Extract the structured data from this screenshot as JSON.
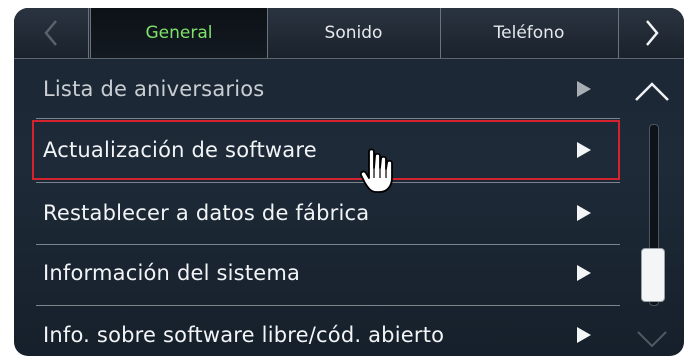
{
  "tabs": [
    {
      "label": "General",
      "active": true
    },
    {
      "label": "Sonido",
      "active": false
    },
    {
      "label": "Teléfono",
      "active": false
    }
  ],
  "list": {
    "items": [
      {
        "label": "Lista de aniversarios",
        "dimmed": true
      },
      {
        "label": "Actualización de software",
        "selected": true
      },
      {
        "label": "Restablecer a datos de fábrica"
      },
      {
        "label": "Información del sistema"
      },
      {
        "label": "Info. sobre software libre/cód. abierto"
      }
    ]
  },
  "icons": {
    "prev": "chevron-left-icon",
    "next": "chevron-right-icon",
    "row": "play-arrow-icon",
    "scroll_up": "chevron-up-icon",
    "scroll_down": "chevron-down-icon",
    "cursor": "hand-pointer-icon"
  },
  "colors": {
    "active_tab_text": "#7ee36a",
    "selection_border": "#d4222e",
    "background": "#1e2a38"
  },
  "scroll": {
    "position_fraction": 0.72
  }
}
